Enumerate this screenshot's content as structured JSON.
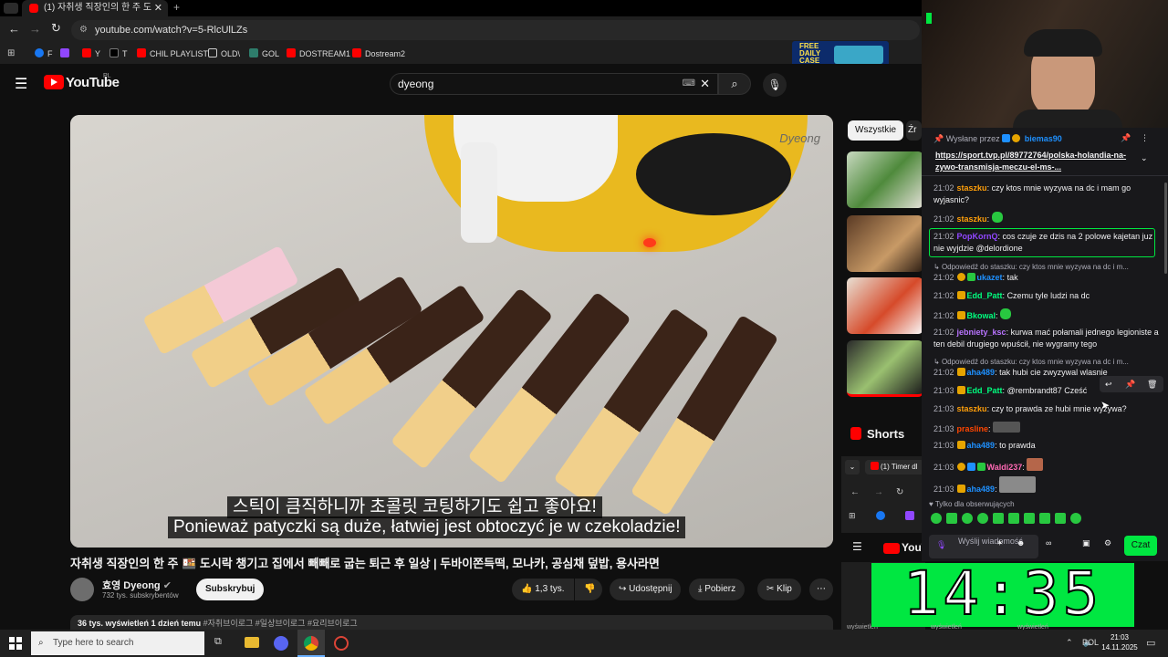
{
  "browser": {
    "tab_title": "(1) 자취생 직장인의 한 주 도",
    "url": "youtube.com/watch?v=5-RlcUlLZs",
    "bookmarks": [
      "F",
      "Y",
      "T",
      "CHIL PLAYLIST",
      "OLD\\",
      "GOL",
      "DOSTREAM1",
      "Dostream2"
    ],
    "ad_text_1": "FREE",
    "ad_text_2": "DAILY",
    "ad_text_3": "CASE"
  },
  "youtube": {
    "logo": "YouTube",
    "region": "PL",
    "search_value": "dyeong",
    "video_watermark": "Dyeong",
    "subtitle_korean": "스틱이 큼직하니까 초콜릿 코팅하기도 쉽고 좋아요!",
    "subtitle_polish": "Ponieważ patyczki są duże, łatwiej jest obtoczyć je w czekoladzie!",
    "title": "자취생 직장인의 한 주 🍱 도시락 챙기고 집에서 빼빼로 굽는 퇴근 후 일상 | 두바이쫀득떡, 모나카, 공심채 덮밥, 용사라면",
    "channel_name": "효영 Dyeong",
    "subscribers": "732 tys. subskrybentów",
    "subscribe_label": "Subskrybuj",
    "likes": "1,3 tys.",
    "share_label": "Udostępnij",
    "download_label": "Pobierz",
    "clip_label": "Klip",
    "views_line": "36 tys. wyświetleń",
    "date_line": "1 dzień temu",
    "hashtags": "#자취브이로그 #일상브이로그 #요리브이로그",
    "chip_all": "Wszystkie",
    "chip_partial": "Źr",
    "shorts_label": "Shorts"
  },
  "popup_window": {
    "tab_title": "(1) Timer dl"
  },
  "chat": {
    "pinned_by": "Wysłane przez",
    "pinned_user": "biemas90",
    "pinned_link": "https://sport.tvp.pl/89772764/polska-holandia-na-zywo-transmisja-meczu-el-ms-...",
    "messages": [
      {
        "time": "21:02",
        "user": "staszku",
        "text": "czy ktos mnie wyzywa na dc i mam go wyjasnic?",
        "color": "#ff9f0a"
      },
      {
        "time": "21:02",
        "user": "staszku",
        "text": "",
        "color": "#ff9f0a"
      },
      {
        "time": "21:02",
        "user": "PopKornQ",
        "text": "cos czuje ze dzis na 2 polowe kajetan juz nie wyjdzie @delordione",
        "color": "#9147ff"
      },
      {
        "time": "",
        "user": "",
        "text": "Odpowiedź do staszku: czy ktos mnie wyzywa na dc i m...",
        "color": "#adadb8"
      },
      {
        "time": "21:02",
        "user": "ukazet",
        "text": "tak",
        "color": "#1e90ff"
      },
      {
        "time": "21:02",
        "user": "Edd_Patt",
        "text": "Czemu tyle ludzi na dc",
        "color": "#00ff7f"
      },
      {
        "time": "21:02",
        "user": "Bkowal",
        "text": "",
        "color": "#00ff7f"
      },
      {
        "time": "21:02",
        "user": "jebniety_ksc",
        "text": "kurwa mać połamali jednego legioniste a ten debil drugiego wpuścił, nie wygramy tego",
        "color": "#b974ff"
      },
      {
        "time": "",
        "user": "",
        "text": "Odpowiedź do staszku: czy ktos mnie wyzywa na dc i m...",
        "color": "#adadb8"
      },
      {
        "time": "21:02",
        "user": "aha489",
        "text": "tak hubi cie zwyzywal wlasnie",
        "color": "#1e90ff"
      },
      {
        "time": "21:03",
        "user": "Edd_Patt",
        "text": "@rembrandt87 Cześć",
        "color": "#00ff7f"
      },
      {
        "time": "21:03",
        "user": "staszku",
        "text": "czy to prawda ze hubi mnie wyzywa?",
        "color": "#ff9f0a"
      },
      {
        "time": "21:03",
        "user": "prasline",
        "text": "",
        "color": "#ff4500"
      },
      {
        "time": "21:03",
        "user": "aha489",
        "text": "to prawda",
        "color": "#1e90ff"
      },
      {
        "time": "21:03",
        "user": "Waldi237",
        "text": "",
        "color": "#ff69b4"
      },
      {
        "time": "21:03",
        "user": "aha489",
        "text": "",
        "color": "#1e90ff"
      }
    ],
    "followers_only": "Tylko dla obserwujących",
    "input_placeholder": "Wyślij wiadomość",
    "send_label": "Czat",
    "timer": "14:35",
    "bottom_labels": [
      "wyświetleń",
      "wyświetleń",
      "wyświetleń"
    ]
  },
  "taskbar": {
    "search_placeholder": "Type here to search",
    "lang": "POL",
    "time": "21:03",
    "date": "14.11.2025"
  },
  "colors": {
    "accent_green": "#00e741",
    "yt_red": "#ff0000",
    "twitch_purple": "#9147ff"
  }
}
